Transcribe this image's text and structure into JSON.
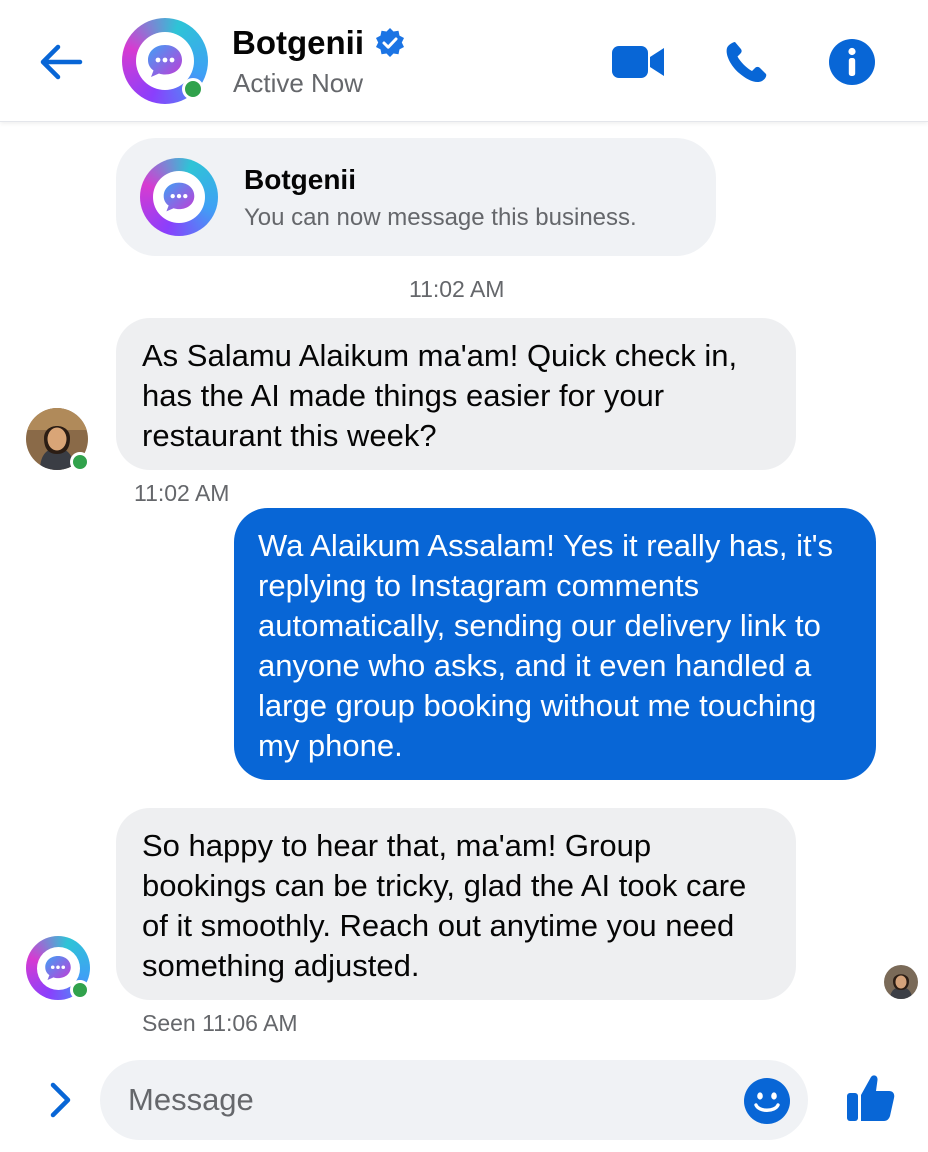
{
  "header": {
    "title": "Botgenii",
    "status": "Active Now",
    "icons": [
      "back-arrow-icon",
      "video-camera-icon",
      "phone-icon",
      "info-icon",
      "verified-badge-icon"
    ]
  },
  "business_card": {
    "name": "Botgenii",
    "subtitle": "You can now message this business."
  },
  "messages": [
    {
      "type": "timestamp",
      "text": "11:02 AM"
    },
    {
      "type": "incoming",
      "text": "As Salamu Alaikum ma'am! Quick check in, has the AI made things easier for your restaurant this week?"
    },
    {
      "type": "timestamp",
      "text": "11:02 AM"
    },
    {
      "type": "outgoing",
      "text": "Wa Alaikum Assalam! Yes it really has, it's replying to Instagram comments automatically, sending our delivery link to anyone who asks, and it even handled a large group booking without me touching my phone."
    },
    {
      "type": "incoming",
      "text": "So happy to hear that, ma'am! Group bookings can be tricky, glad the AI took care of it smoothly. Reach out anytime you need something adjusted."
    },
    {
      "type": "seen",
      "text": "Seen 11:06 AM"
    }
  ],
  "composer": {
    "placeholder": "Message",
    "icons": [
      "chevron-right-icon",
      "emoji-icon",
      "thumbs-up-icon"
    ]
  },
  "colors": {
    "accent": "#0866d6",
    "incoming_bubble": "#eeeff1",
    "online": "#31a24c",
    "muted_text": "#65676b"
  }
}
